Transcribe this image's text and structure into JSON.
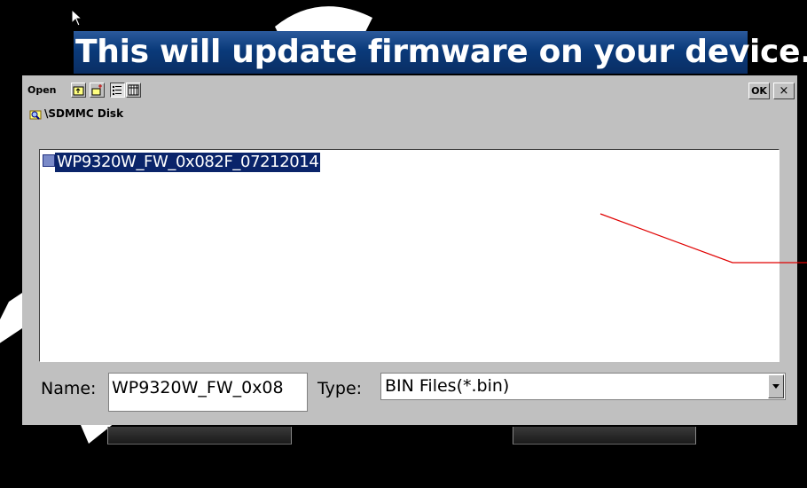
{
  "banner": {
    "text": "This will update firmware on your device."
  },
  "toolbar": {
    "open_label": "Open",
    "ok_label": "OK",
    "close_label": "×",
    "icons": [
      "up-folder-icon",
      "new-folder-icon",
      "list-view-icon",
      "details-view-icon"
    ]
  },
  "path": {
    "text": "\\SDMMC Disk"
  },
  "files": [
    {
      "name": "WP9320W_FW_0x082F_07212014",
      "selected": true
    }
  ],
  "form": {
    "name_label": "Name:",
    "name_value": "WP9320W_FW_0x08",
    "type_label": "Type:",
    "type_value": "BIN Files(*.bin)"
  },
  "colors": {
    "selection": "#0a246a",
    "dialog_bg": "#c0c0c0",
    "annotation_line": "#e00000"
  }
}
